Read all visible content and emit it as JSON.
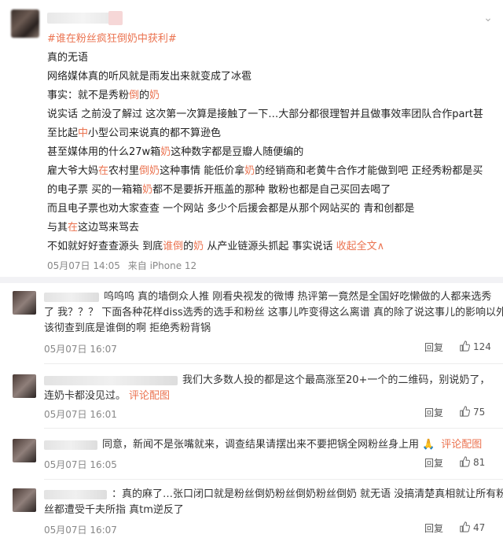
{
  "post": {
    "hashtag": "#谁在粉丝疯狂倒奶中获利#",
    "lines": [
      {
        "parts": [
          {
            "t": "真的无语"
          }
        ]
      },
      {
        "parts": [
          {
            "t": "网络媒体真的听风就是雨发出来就变成了冰雹"
          }
        ]
      },
      {
        "parts": [
          {
            "t": "事实：就不是秀粉"
          },
          {
            "t": "倒",
            "kw": true
          },
          {
            "t": "的"
          },
          {
            "t": "奶",
            "kw": true
          }
        ]
      },
      {
        "parts": [
          {
            "t": "说实话 之前没了解过 这次第一次算是接触了一下…大部分都很理智并且做事效率团队合作part甚"
          }
        ]
      },
      {
        "parts": [
          {
            "t": "至比起"
          },
          {
            "t": "中",
            "kw": true
          },
          {
            "t": "小型公司来说真的都不算逊色"
          }
        ]
      },
      {
        "parts": [
          {
            "t": "甚至媒体用的什么27w箱"
          },
          {
            "t": "奶",
            "kw": true
          },
          {
            "t": "这种数字都是豆瓣人随便编的"
          }
        ]
      },
      {
        "parts": [
          {
            "t": "雇大爷大妈"
          },
          {
            "t": "在",
            "kw": true
          },
          {
            "t": "农村里"
          },
          {
            "t": "倒奶",
            "kw": true
          },
          {
            "t": "这种事情 能低价拿"
          },
          {
            "t": "奶",
            "kw": true
          },
          {
            "t": "的经销商和老黄牛合作才能做到吧 正经秀粉都是买"
          }
        ]
      },
      {
        "parts": [
          {
            "t": "的电子票 买的一箱箱"
          },
          {
            "t": "奶",
            "kw": true
          },
          {
            "t": "都不是要拆开瓶盖的那种 散粉也都是自己买回去喝了"
          }
        ]
      },
      {
        "parts": [
          {
            "t": "而且电子票也劝大家查查 一个网站 多少个后援会都是从那个网站买的 青和创都是"
          }
        ]
      },
      {
        "parts": [
          {
            "t": "与其"
          },
          {
            "t": "在",
            "kw": true
          },
          {
            "t": "这边骂来骂去"
          }
        ]
      },
      {
        "parts": [
          {
            "t": "不如就好好查查源头 到底"
          },
          {
            "t": "谁倒",
            "kw": true
          },
          {
            "t": "的"
          },
          {
            "t": "奶",
            "kw": true
          },
          {
            "t": " 从产业链源头抓起 事实说话 "
          },
          {
            "t": "收起全文",
            "link": true
          },
          {
            "t": "∧",
            "link": true
          }
        ]
      }
    ],
    "time": "05月07日 14:05",
    "source": "来自 iPhone 12"
  },
  "comments": [
    {
      "lines": [
        "呜呜呜 真的墙倒众人推 刚看央视发的微博 热评第一竟然是全国好吃懒做的人都来选秀",
        "了 我？？？ 下面各种花样diss选秀的选手和粉丝 这事儿咋变得这么离谱 真的除了说这事儿的影响以外应",
        "该彻查到底是谁倒的啊 拒绝秀粉背锅"
      ],
      "time": "05月07日 16:07",
      "reply": "回复",
      "likes": "124"
    },
    {
      "lines": [
        "我们大多数人投的都是这个最高涨至20+一个的二维码，别说奶了，",
        "连奶卡都没见过。"
      ],
      "extra": "评论配图",
      "time": "05月07日 16:01",
      "reply": "回复",
      "likes": "75"
    },
    {
      "lines": [
        "同意，新闻不是张嘴就来，调查结果请摆出来不要把锅全网粉丝身上用"
      ],
      "extra": "评论配图",
      "time": "05月07日 16:05",
      "reply": "回复",
      "likes": "81"
    },
    {
      "lines": [
        "：真的麻了…张口闭口就是粉丝倒奶粉丝倒奶粉丝倒奶 就无语 没搞清楚真相就让所有粉",
        "丝都遭受千夫所指 真tm逆反了"
      ],
      "time": "05月07日 16:07",
      "reply": "回复",
      "likes": "47"
    }
  ]
}
